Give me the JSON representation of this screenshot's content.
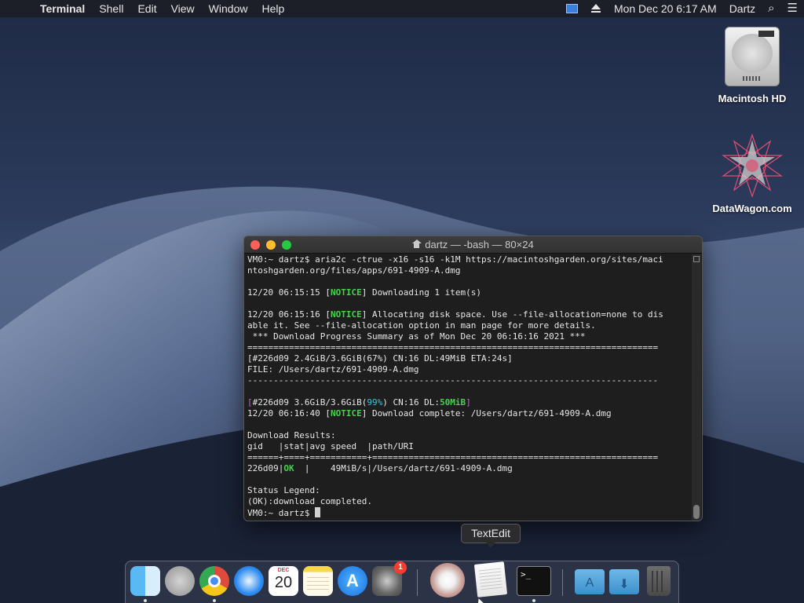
{
  "menubar": {
    "app_name": "Terminal",
    "menus": [
      "Shell",
      "Edit",
      "View",
      "Window",
      "Help"
    ],
    "clock": "Mon Dec 20  6:17 AM",
    "user": "Dartz"
  },
  "desktop": {
    "icons": [
      {
        "label": "Macintosh HD"
      },
      {
        "label": "DataWagon.com"
      }
    ]
  },
  "terminal": {
    "title": "dartz — -bash — 80×24",
    "lines": [
      {
        "segments": [
          {
            "text": "VM0:~ dartz$ aria2c -ctrue -x16 -s16 -k1M https://macintoshgarden.org/sites/maci",
            "style": ""
          }
        ]
      },
      {
        "segments": [
          {
            "text": "ntoshgarden.org/files/apps/691-4909-A.dmg",
            "style": ""
          }
        ]
      },
      {
        "segments": [
          {
            "text": "",
            "style": ""
          }
        ]
      },
      {
        "segments": [
          {
            "text": "12/20 06:15:15 [",
            "style": ""
          },
          {
            "text": "NOTICE",
            "style": "green"
          },
          {
            "text": "] Downloading 1 item(s)",
            "style": ""
          }
        ]
      },
      {
        "segments": [
          {
            "text": "",
            "style": ""
          }
        ]
      },
      {
        "segments": [
          {
            "text": "12/20 06:15:16 [",
            "style": ""
          },
          {
            "text": "NOTICE",
            "style": "green"
          },
          {
            "text": "] Allocating disk space. Use --file-allocation=none to dis",
            "style": ""
          }
        ]
      },
      {
        "segments": [
          {
            "text": "able it. See --file-allocation option in man page for more details.",
            "style": ""
          }
        ]
      },
      {
        "segments": [
          {
            "text": " *** Download Progress Summary as of Mon Dec 20 06:16:16 2021 ***",
            "style": ""
          }
        ]
      },
      {
        "segments": [
          {
            "text": "===============================================================================",
            "style": ""
          }
        ]
      },
      {
        "segments": [
          {
            "text": "[#226d09 2.4GiB/3.6GiB(67%) CN:16 DL:49MiB ETA:24s]",
            "style": ""
          }
        ]
      },
      {
        "segments": [
          {
            "text": "FILE: /Users/dartz/691-4909-A.dmg",
            "style": ""
          }
        ]
      },
      {
        "segments": [
          {
            "text": "-------------------------------------------------------------------------------",
            "style": ""
          }
        ]
      },
      {
        "segments": [
          {
            "text": "",
            "style": ""
          }
        ]
      },
      {
        "segments": [
          {
            "text": "[",
            "style": "magenta"
          },
          {
            "text": "#226d09 3.6GiB/3.6GiB(",
            "style": ""
          },
          {
            "text": "99%",
            "style": "cyan"
          },
          {
            "text": ") CN:16 DL:",
            "style": ""
          },
          {
            "text": "50MiB",
            "style": "green"
          },
          {
            "text": "]",
            "style": "magenta"
          }
        ]
      },
      {
        "segments": [
          {
            "text": "12/20 06:16:40 [",
            "style": ""
          },
          {
            "text": "NOTICE",
            "style": "green"
          },
          {
            "text": "] Download complete: /Users/dartz/691-4909-A.dmg",
            "style": ""
          }
        ]
      },
      {
        "segments": [
          {
            "text": "",
            "style": ""
          }
        ]
      },
      {
        "segments": [
          {
            "text": "Download Results:",
            "style": ""
          }
        ]
      },
      {
        "segments": [
          {
            "text": "gid   |stat|avg speed  |path/URI",
            "style": ""
          }
        ]
      },
      {
        "segments": [
          {
            "text": "======+====+===========+=======================================================",
            "style": ""
          }
        ]
      },
      {
        "segments": [
          {
            "text": "226d09|",
            "style": ""
          },
          {
            "text": "OK",
            "style": "green"
          },
          {
            "text": "  |    49MiB/s|/Users/dartz/691-4909-A.dmg",
            "style": ""
          }
        ]
      },
      {
        "segments": [
          {
            "text": "",
            "style": ""
          }
        ]
      },
      {
        "segments": [
          {
            "text": "Status Legend:",
            "style": ""
          }
        ]
      },
      {
        "segments": [
          {
            "text": "(OK):download completed.",
            "style": ""
          }
        ]
      },
      {
        "segments": [
          {
            "text": "VM0:~ dartz$ ",
            "style": ""
          }
        ]
      }
    ]
  },
  "tooltip": "TextEdit",
  "dock": {
    "items": [
      {
        "name": "finder",
        "running": true
      },
      {
        "name": "launchpad",
        "running": false
      },
      {
        "name": "chrome",
        "running": true
      },
      {
        "name": "safari",
        "running": false
      },
      {
        "name": "calendar",
        "month": "DEC",
        "day": "20",
        "running": false
      },
      {
        "name": "notes",
        "running": false
      },
      {
        "name": "app-store",
        "running": false
      },
      {
        "name": "system-preferences",
        "badge": "1",
        "running": false
      },
      {
        "name": "photo-booth",
        "running": false
      },
      {
        "name": "textedit",
        "running": false
      },
      {
        "name": "terminal",
        "glyph": ">_",
        "running": true
      },
      {
        "name": "applications-folder",
        "running": false
      },
      {
        "name": "downloads-folder",
        "running": false
      },
      {
        "name": "trash",
        "running": false
      }
    ]
  }
}
